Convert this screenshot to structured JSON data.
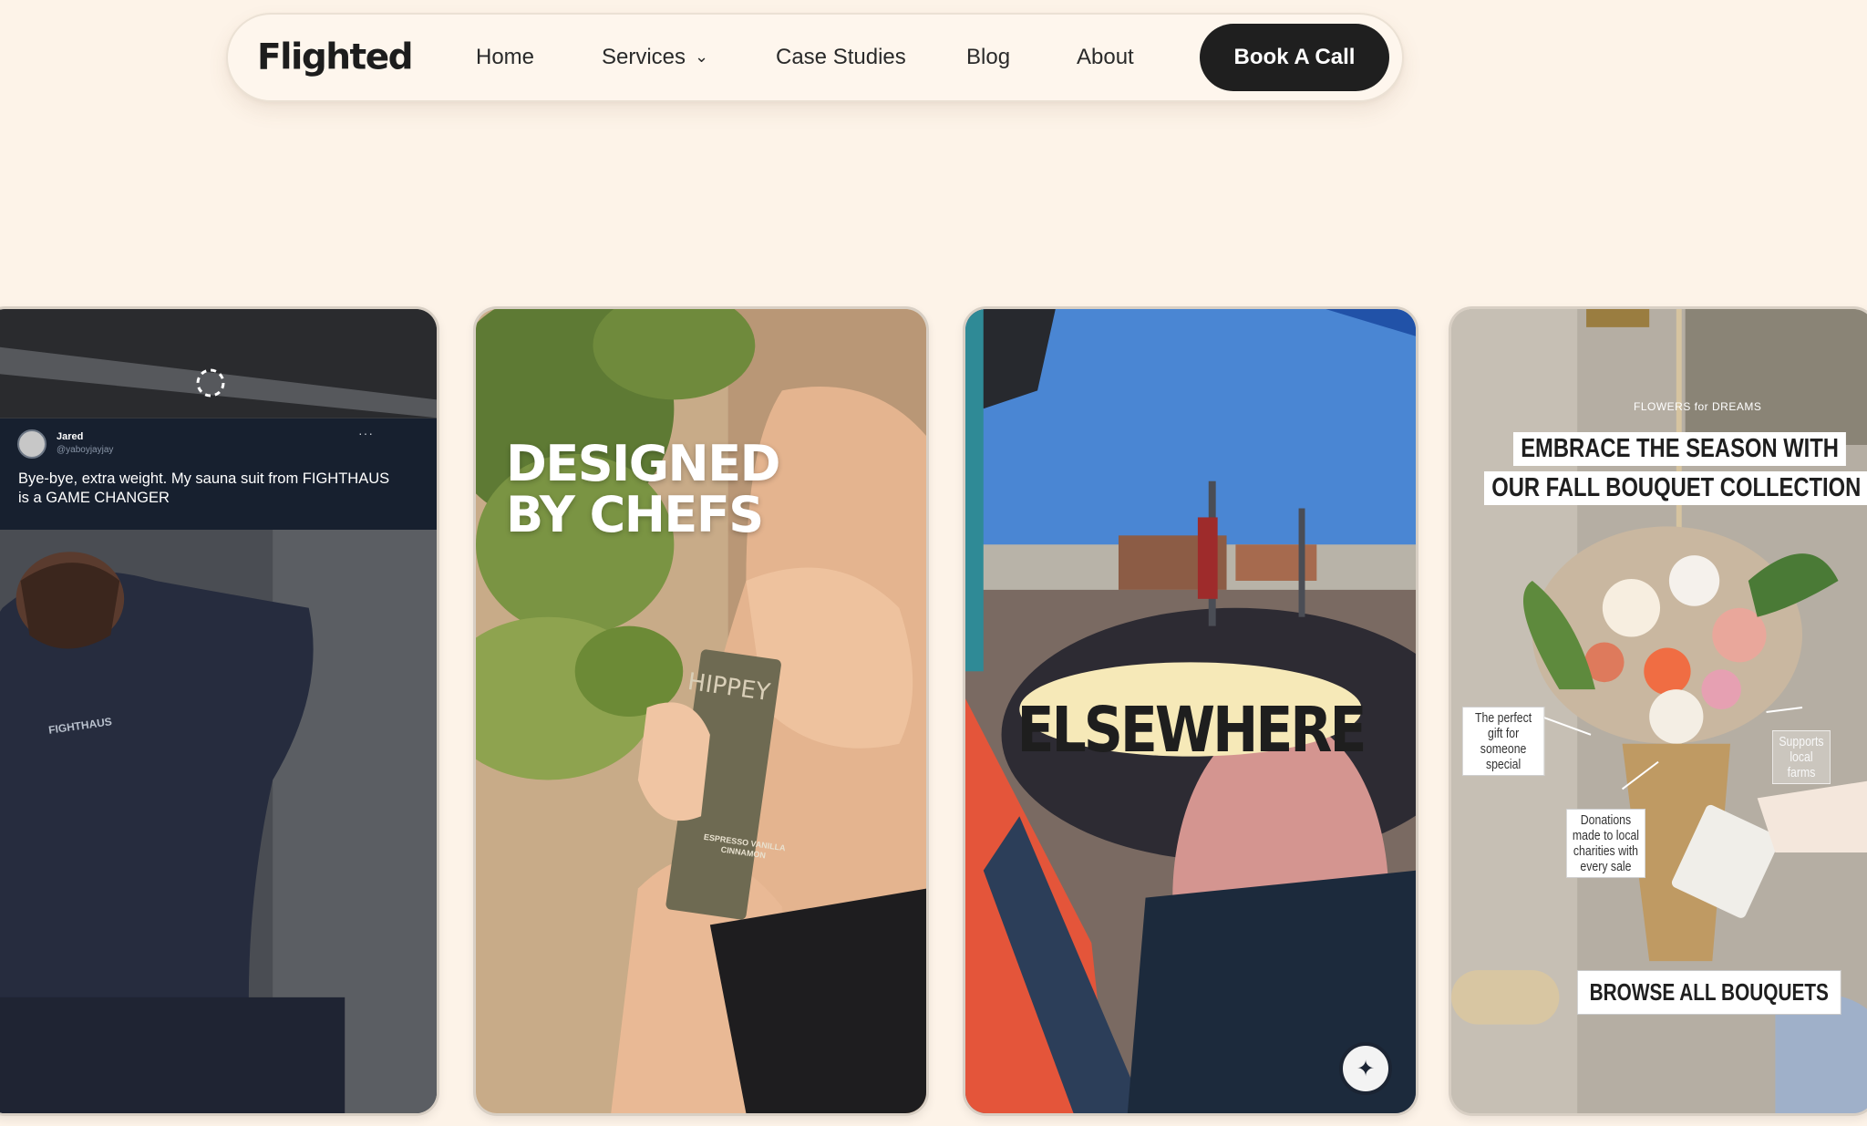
{
  "nav": {
    "logo": "Flighted",
    "links": [
      "Home",
      "Services",
      "Case Studies",
      "Blog",
      "About"
    ],
    "cta": "Book A Call"
  },
  "cards": [
    {
      "tweet": {
        "name": "Jared",
        "handle": "@yaboyjayjay",
        "more": "···",
        "text": "Bye-bye, extra weight. My sauna suit from FIGHTHAUS is a GAME CHANGER"
      },
      "apparel_text": "FIGHTHAUS"
    },
    {
      "headline_line1": "DESIGNED",
      "headline_line2": "BY CHEFS",
      "bar_brand": "HIPPEY",
      "bar_flavor": "ESPRESSO VANILLA CINNAMON"
    },
    {
      "badge": "ELSEWHERE"
    },
    {
      "brand": "FLOWERS for DREAMS",
      "banner_line1": "EMBRACE THE SEASON WITH",
      "banner_line2": "OUR FALL BOUQUET COLLECTION",
      "label_gift": "The perfect gift for someone special",
      "label_farms": "Supports local farms",
      "label_donations": "Donations made to local charities with every sale",
      "browse_button": "BROWSE ALL BOUQUETS"
    }
  ],
  "colors": {
    "page_bg": "#fdf3e8",
    "cta_bg": "#1f1f1f",
    "tweet_bg": "#17202f"
  }
}
